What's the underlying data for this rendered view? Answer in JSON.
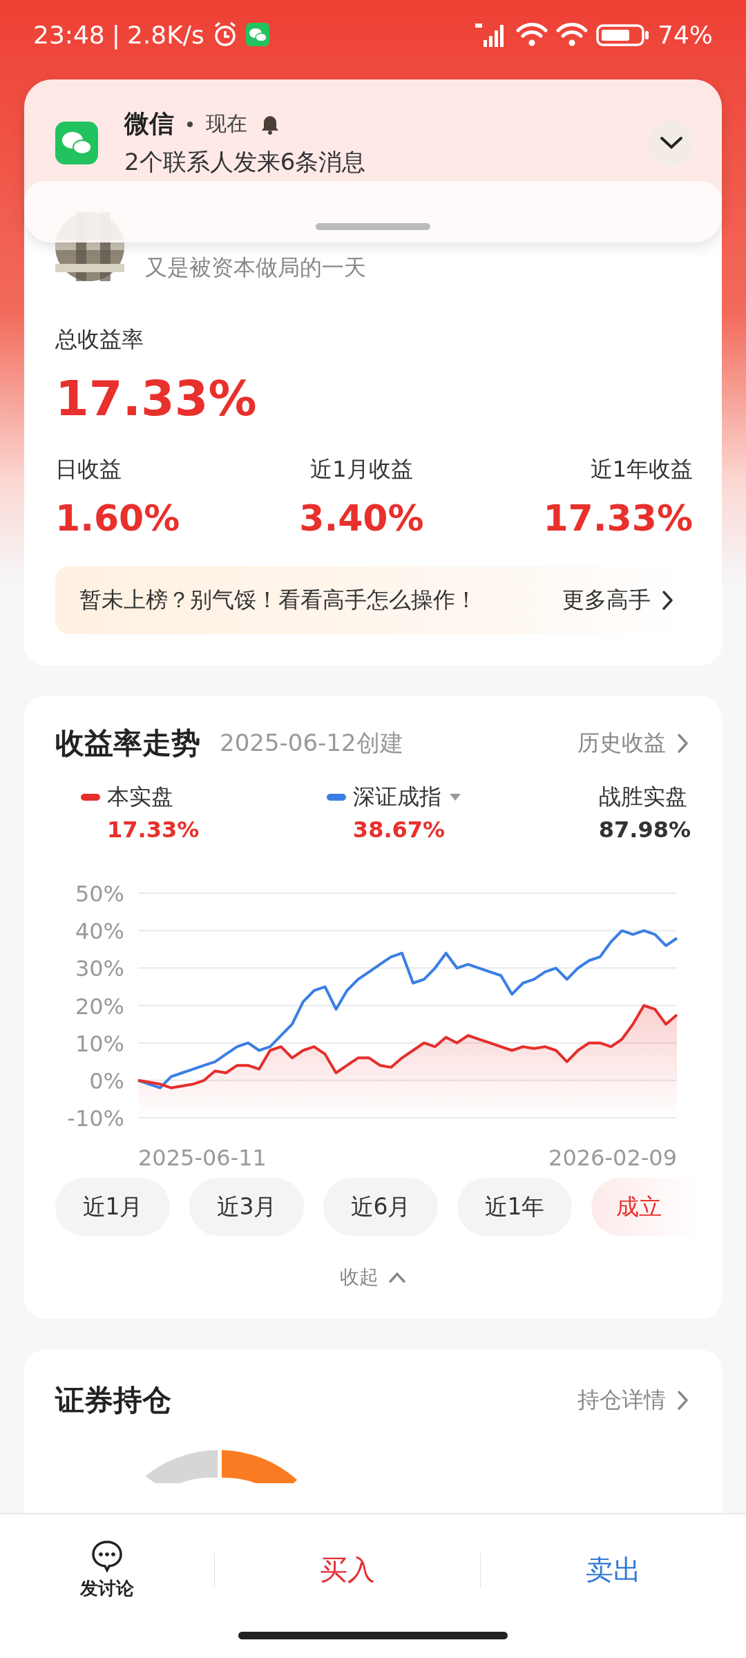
{
  "status_bar": {
    "time": "23:48",
    "separator": "|",
    "speed": "2.8K/s",
    "battery": "74%"
  },
  "notification": {
    "app": "微信",
    "time": "现在",
    "message": "2个联系人发来6条消息"
  },
  "profile": {
    "bio": "又是被资本做局的一天",
    "total_label": "总收益率",
    "total_value": "17.33%",
    "stats": [
      {
        "label": "日收益",
        "value": "1.60%"
      },
      {
        "label": "近1月收益",
        "value": "3.40%"
      },
      {
        "label": "近1年收益",
        "value": "17.33%"
      }
    ],
    "banner": {
      "text": "暂未上榜？别气馁！看看高手怎么操作！",
      "link": "更多高手"
    }
  },
  "trend": {
    "title": "收益率走势",
    "created": "2025-06-12创建",
    "history_link": "历史收益",
    "legend": [
      {
        "value": "17.33%",
        "dropdown": false
      },
      {
        "value": "38.67%",
        "dropdown": true
      }
    ],
    "beat": {
      "label": "战胜实盘",
      "value": "87.98%"
    },
    "x_labels": [
      "2025-06-11",
      "2026-02-09"
    ],
    "chart_data": {
      "type": "line",
      "grid": true,
      "ylim": [
        -10,
        50
      ],
      "yticks": [
        {
          "value": 50,
          "label": "50%"
        },
        {
          "value": 40,
          "label": "40%"
        },
        {
          "value": 30,
          "label": "30%"
        },
        {
          "value": 20,
          "label": "20%"
        },
        {
          "value": 10,
          "label": "10%"
        },
        {
          "value": 0,
          "label": "0%"
        },
        {
          "value": -10,
          "label": "-10%"
        }
      ],
      "series": [
        {
          "name": "本实盘",
          "color": "#e62e2b",
          "values": [
            0,
            -0.5,
            -1,
            -2,
            -1.5,
            -1,
            0,
            2.5,
            2,
            4,
            4,
            3,
            8,
            9,
            6,
            8,
            9,
            7,
            2,
            4,
            6,
            6,
            4,
            3.5,
            6,
            8,
            10,
            9,
            11.5,
            10,
            12,
            11,
            10,
            9,
            8,
            9,
            8.5,
            9,
            8,
            5,
            8,
            10,
            10,
            9,
            11,
            15,
            20,
            19,
            15,
            17.5
          ]
        },
        {
          "name": "深证成指",
          "color": "#3a7ee3",
          "values": [
            0,
            -1,
            -2,
            1,
            2,
            3,
            4,
            5,
            7,
            9,
            10,
            8,
            9,
            12,
            15,
            21,
            24,
            25,
            19,
            24,
            27,
            29,
            31,
            33,
            34,
            26,
            27,
            30,
            34,
            30,
            31,
            30,
            29,
            28,
            23,
            26,
            27,
            29,
            30,
            27,
            30,
            32,
            33,
            37,
            40,
            39,
            40,
            39,
            36,
            38
          ]
        }
      ]
    },
    "ranges": [
      {
        "label": "近1月",
        "selected": false
      },
      {
        "label": "近3月",
        "selected": false
      },
      {
        "label": "近6月",
        "selected": false
      },
      {
        "label": "近1年",
        "selected": false
      },
      {
        "label": "成立",
        "selected": true
      }
    ],
    "collapse": "收起"
  },
  "holdings": {
    "title": "证券持仓",
    "detail_link": "持仓详情"
  },
  "bottom_bar": {
    "discuss": "发讨论",
    "buy": "买入",
    "sell": "卖出"
  }
}
